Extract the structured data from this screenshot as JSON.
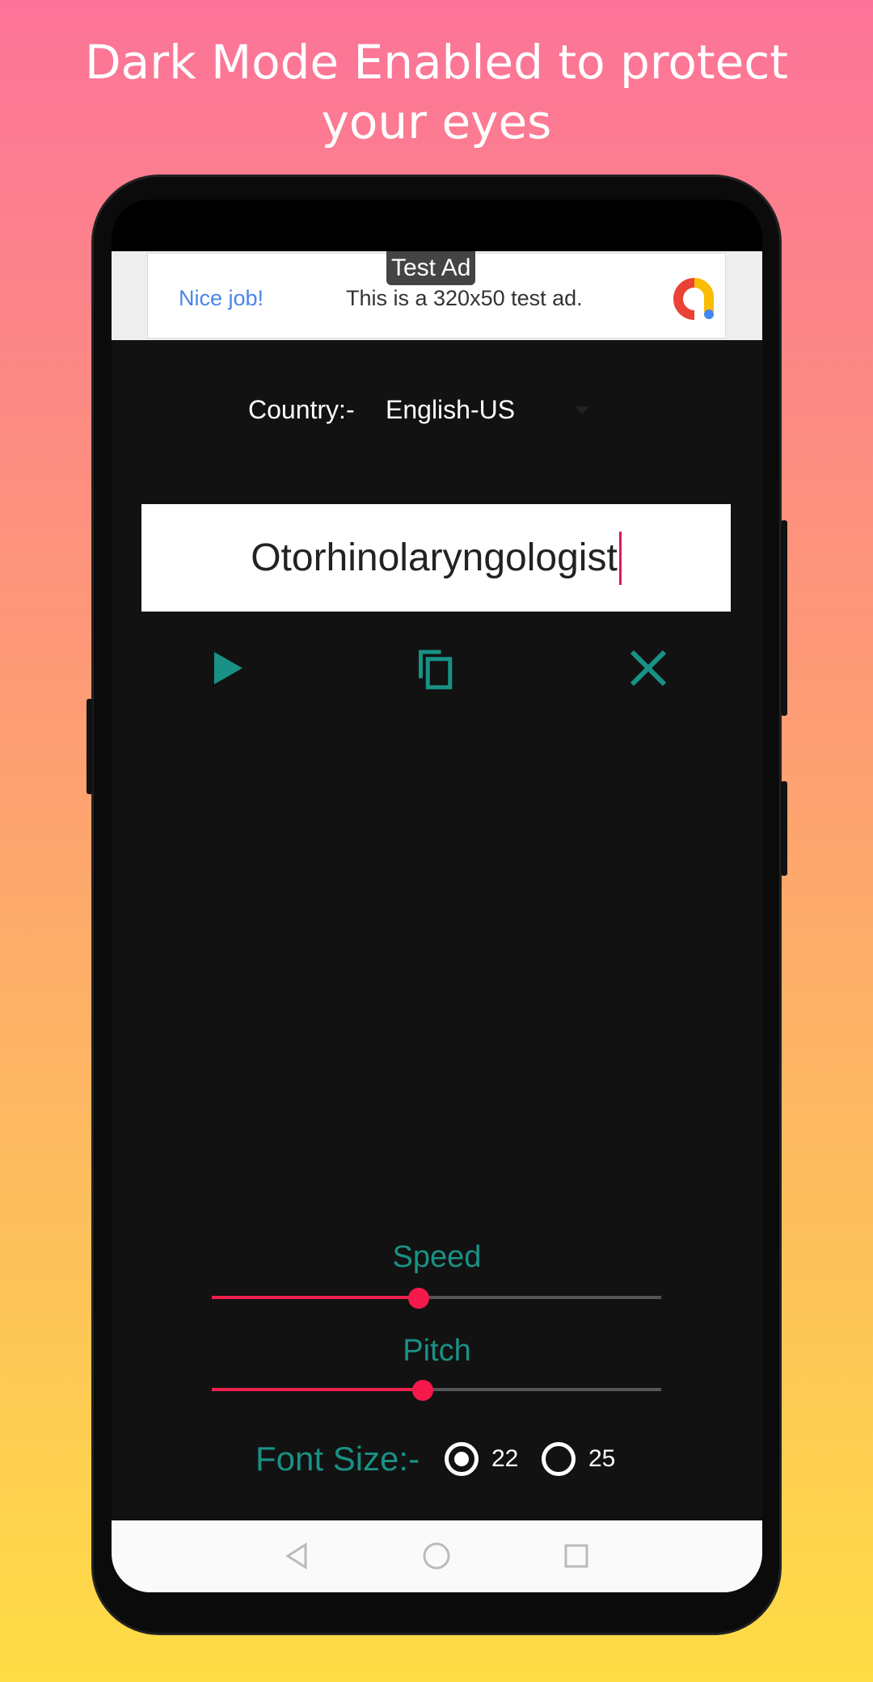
{
  "headline": {
    "line1": "Dark Mode Enabled to protect",
    "line2": "your eyes"
  },
  "ad": {
    "badge": "Test Ad",
    "title": "Nice job!",
    "text": "This is a 320x50 test ad."
  },
  "country": {
    "label": "Country:-",
    "value": "English-US"
  },
  "input": {
    "value": "Otorhinolaryngologist"
  },
  "actions": [
    {
      "icon": "play-icon"
    },
    {
      "icon": "copy-icon"
    },
    {
      "icon": "close-icon"
    }
  ],
  "speed": {
    "label": "Speed",
    "value_fraction": 0.46
  },
  "pitch": {
    "label": "Pitch",
    "value_fraction": 0.47
  },
  "font_size": {
    "label": "Font Size:-",
    "options": [
      {
        "label": "22",
        "selected": true
      },
      {
        "label": "25",
        "selected": false
      }
    ]
  },
  "colors": {
    "accent": "#199185",
    "slider": "#f0214f",
    "background": "#121212"
  }
}
